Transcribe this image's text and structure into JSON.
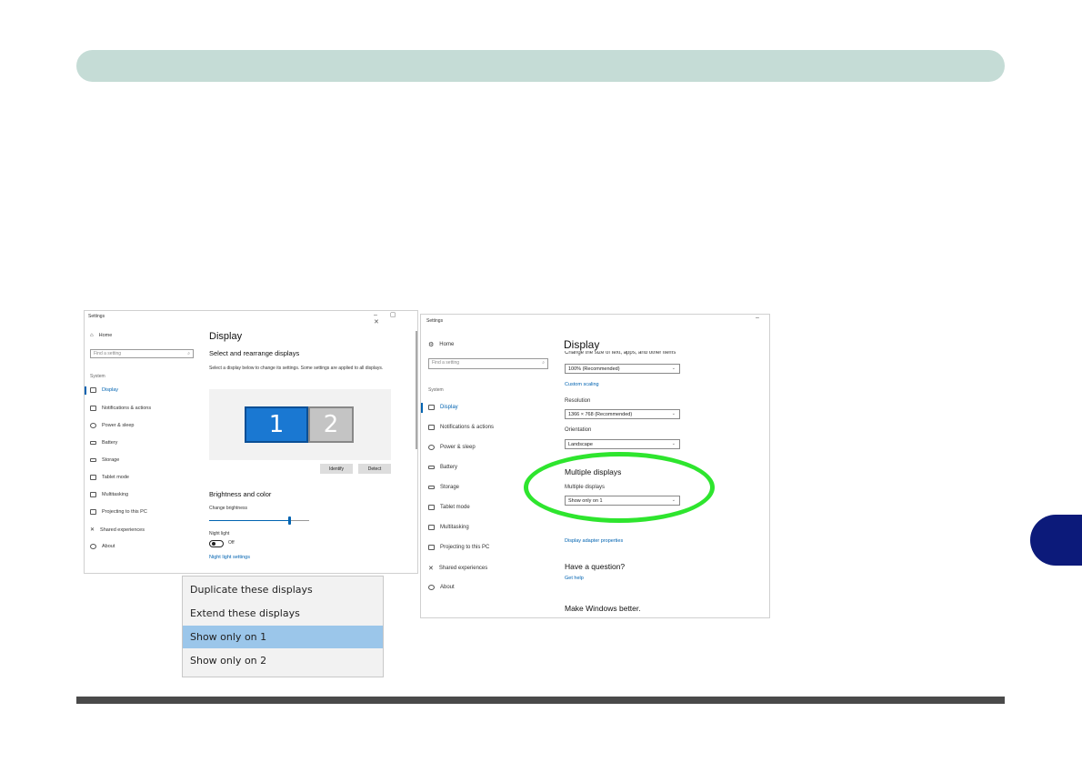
{
  "left_window": {
    "title": "Settings",
    "window_controls": "–  ▢  ✕",
    "nav": {
      "home": "Home",
      "search_placeholder": "Find a setting",
      "group": "System",
      "items": [
        "Display",
        "Notifications & actions",
        "Power & sleep",
        "Battery",
        "Storage",
        "Tablet mode",
        "Multitasking",
        "Projecting to this PC",
        "Shared experiences",
        "About"
      ]
    },
    "content": {
      "title": "Display",
      "section": "Select and rearrange displays",
      "description": "Select a display below to change its settings. Some settings are applied to all displays.",
      "monitor_1": "1",
      "monitor_2": "2",
      "identify_button": "Identify",
      "detect_button": "Detect",
      "brightness_heading": "Brightness and color",
      "brightness_label": "Change brightness",
      "brightness_level": 0.8,
      "night_light_label": "Night light",
      "night_light_state": "Off",
      "night_light_link": "Night light settings"
    }
  },
  "right_window": {
    "title": "Settings",
    "window_controls": "–",
    "nav": {
      "home": "Home",
      "search_placeholder": "Find a setting",
      "group": "System",
      "items": [
        "Display",
        "Notifications & actions",
        "Power & sleep",
        "Battery",
        "Storage",
        "Tablet mode",
        "Multitasking",
        "Projecting to this PC",
        "Shared experiences",
        "About"
      ]
    },
    "content": {
      "title": "Display",
      "scale_label": "Change the size of text, apps, and other items",
      "scale_value": "100% (Recommended)",
      "custom_scaling_link": "Custom scaling",
      "resolution_label": "Resolution",
      "resolution_value": "1366 × 768 (Recommended)",
      "orientation_label": "Orientation",
      "orientation_value": "Landscape",
      "multiple_heading": "Multiple displays",
      "multiple_label": "Multiple displays",
      "multiple_value": "Show only on 1",
      "adapter_link": "Display adapter properties",
      "question_heading": "Have a question?",
      "help_link": "Get help",
      "better_heading": "Make Windows better."
    }
  },
  "dropdown_popup": {
    "options": [
      "Duplicate these displays",
      "Extend these displays",
      "Show only on 1",
      "Show only on 2"
    ],
    "selected": "Show only on 1"
  },
  "colors": {
    "header_bar": "#c5dcd6",
    "chapter_tab": "#0c1a7a",
    "highlight_ellipse": "#2ee52e",
    "accent": "#0063b1",
    "selected_option": "#9bc6ea"
  }
}
